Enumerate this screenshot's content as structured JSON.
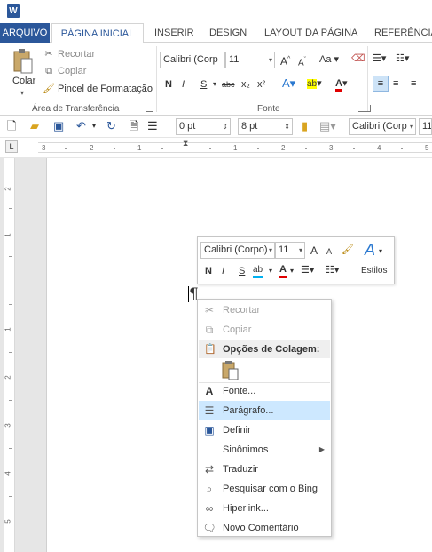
{
  "app": {
    "icon_letter": "W"
  },
  "tabs": [
    {
      "label": "ARQUIVO"
    },
    {
      "label": "PÁGINA INICIAL"
    },
    {
      "label": "INSERIR"
    },
    {
      "label": "DESIGN"
    },
    {
      "label": "LAYOUT DA PÁGINA"
    },
    {
      "label": "REFERÊNCIAS"
    }
  ],
  "ribbon": {
    "clipboard": {
      "paste": "Colar",
      "cut": "Recortar",
      "copy": "Copiar",
      "format_painter": "Pincel de Formatação",
      "group_label": "Área de Transferência"
    },
    "font": {
      "family": "Calibri (Corp",
      "size": "11",
      "grow": "A",
      "shrink": "A",
      "case": "Aa",
      "bold": "N",
      "italic": "I",
      "underline": "S",
      "strikethrough": "abc",
      "subscript": "x₂",
      "superscript": "x²",
      "group_label": "Fonte"
    }
  },
  "quick_access": {
    "spacing_before": "0 pt",
    "spacing_after": "8 pt",
    "font_family": "Calibri (Corp",
    "font_size": "11"
  },
  "ruler": {
    "h_numbers": [
      "3",
      "2",
      "1",
      "1",
      "2",
      "3",
      "4",
      "5"
    ],
    "v_numbers": [
      "2",
      "1",
      "1",
      "2",
      "3",
      "4",
      "5"
    ]
  },
  "mini_toolbar": {
    "font_family": "Calibri (Corpo)",
    "font_size": "11",
    "grow": "A",
    "shrink": "A",
    "bold": "N",
    "italic": "I",
    "underline": "S",
    "highlight": "ab",
    "font_color": "A",
    "styles_label": "Estilos",
    "styles_glyph": "A"
  },
  "document": {
    "pilcrow": "¶"
  },
  "context_menu": {
    "items": [
      {
        "label": "Recortar",
        "enabled": false
      },
      {
        "label": "Copiar",
        "enabled": false
      },
      {
        "label": "Opções de Colagem:",
        "header": true
      },
      {
        "label": "Fonte..."
      },
      {
        "label": "Parágrafo...",
        "highlighted": true
      },
      {
        "label": "Definir"
      },
      {
        "label": "Sinônimos",
        "submenu": true
      },
      {
        "label": "Traduzir"
      },
      {
        "label": "Pesquisar com o Bing"
      },
      {
        "label": "Hiperlink..."
      },
      {
        "label": "Novo Comentário"
      }
    ]
  },
  "colors": {
    "accent": "#2b579a",
    "highlight": "#cde8ff"
  }
}
